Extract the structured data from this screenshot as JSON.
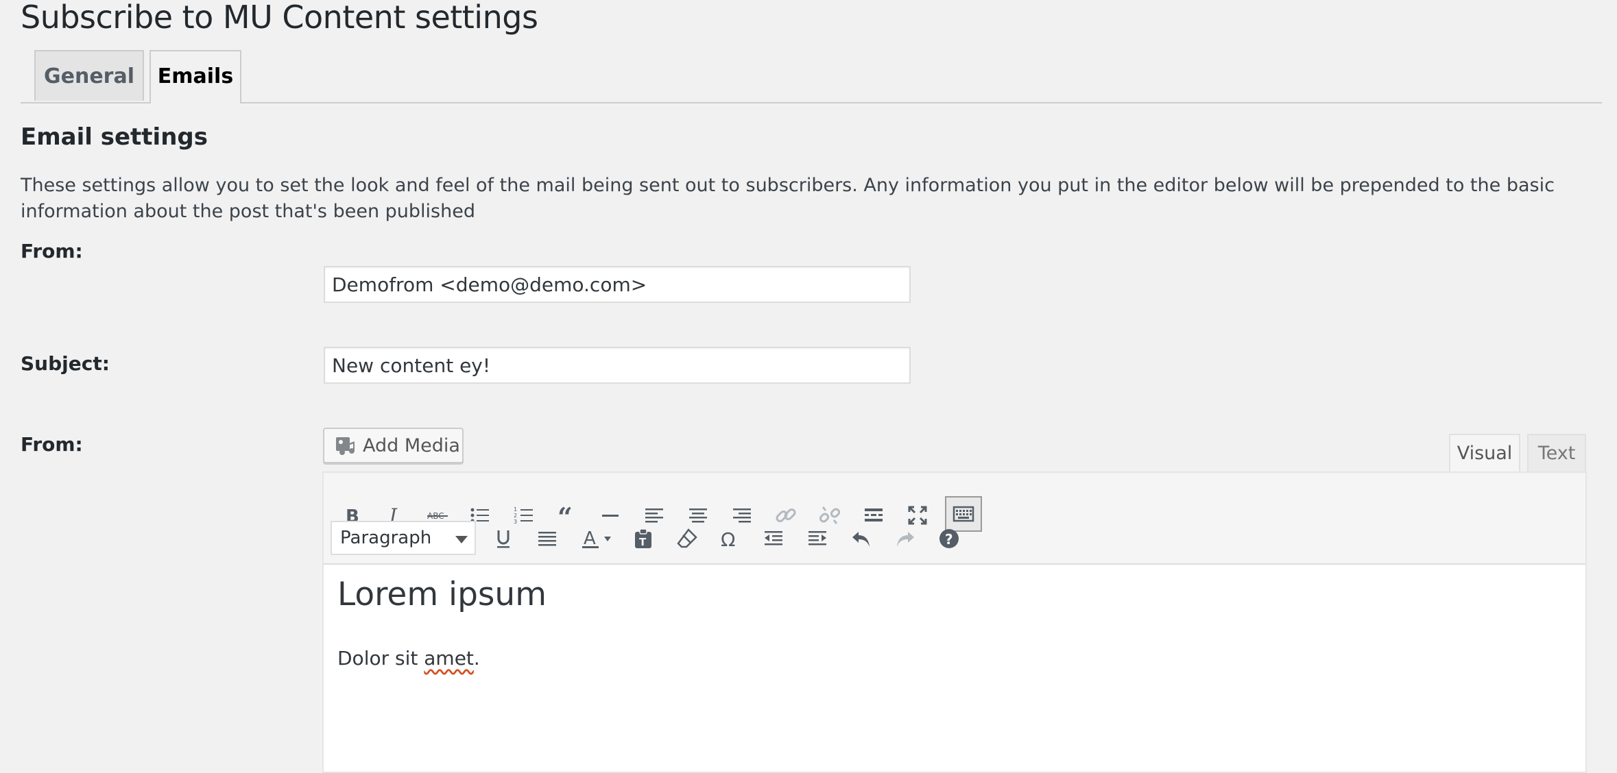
{
  "page": {
    "title": "Subscribe to MU Content settings"
  },
  "tabs": [
    {
      "label": "General",
      "active": false
    },
    {
      "label": "Emails",
      "active": true
    }
  ],
  "section": {
    "title": "Email settings",
    "description": "These settings allow you to set the look and feel of the mail being sent out to subscribers. Any information you put in the editor below will be prepended to the basic information about the post that's been published"
  },
  "fields": {
    "from": {
      "label": "From:",
      "value": "Demofrom <demo@demo.com>"
    },
    "subject": {
      "label": "Subject:",
      "value": "New content ey!"
    },
    "body": {
      "label": "From:"
    }
  },
  "editor": {
    "add_media_label": "Add Media",
    "mode_tabs": {
      "visual": "Visual",
      "text": "Text",
      "active": "visual"
    },
    "format_select": {
      "selected": "Paragraph"
    },
    "toolbar_row1": [
      "bold-icon",
      "italic-icon",
      "strikethrough-icon",
      "bullet-list-icon",
      "numbered-list-icon",
      "blockquote-icon",
      "horizontal-rule-icon",
      "align-left-icon",
      "align-center-icon",
      "align-right-icon",
      "link-icon",
      "unlink-icon",
      "read-more-icon",
      "fullscreen-icon",
      "toolbar-toggle-icon"
    ],
    "toolbar_row2": [
      "underline-icon",
      "justify-icon",
      "text-color-icon",
      "paste-text-icon",
      "clear-formatting-icon",
      "special-character-icon",
      "outdent-icon",
      "indent-icon",
      "undo-icon",
      "redo-icon",
      "help-icon"
    ],
    "content": {
      "heading": "Lorem ipsum",
      "paragraph_before": "Dolor sit ",
      "paragraph_misspelled": "amet",
      "paragraph_after": "."
    }
  },
  "colors": {
    "background": "#f1f1f1",
    "text": "#23282d",
    "border": "#cccccc",
    "icon": "#555d66",
    "icon_disabled": "#b4b9be"
  }
}
